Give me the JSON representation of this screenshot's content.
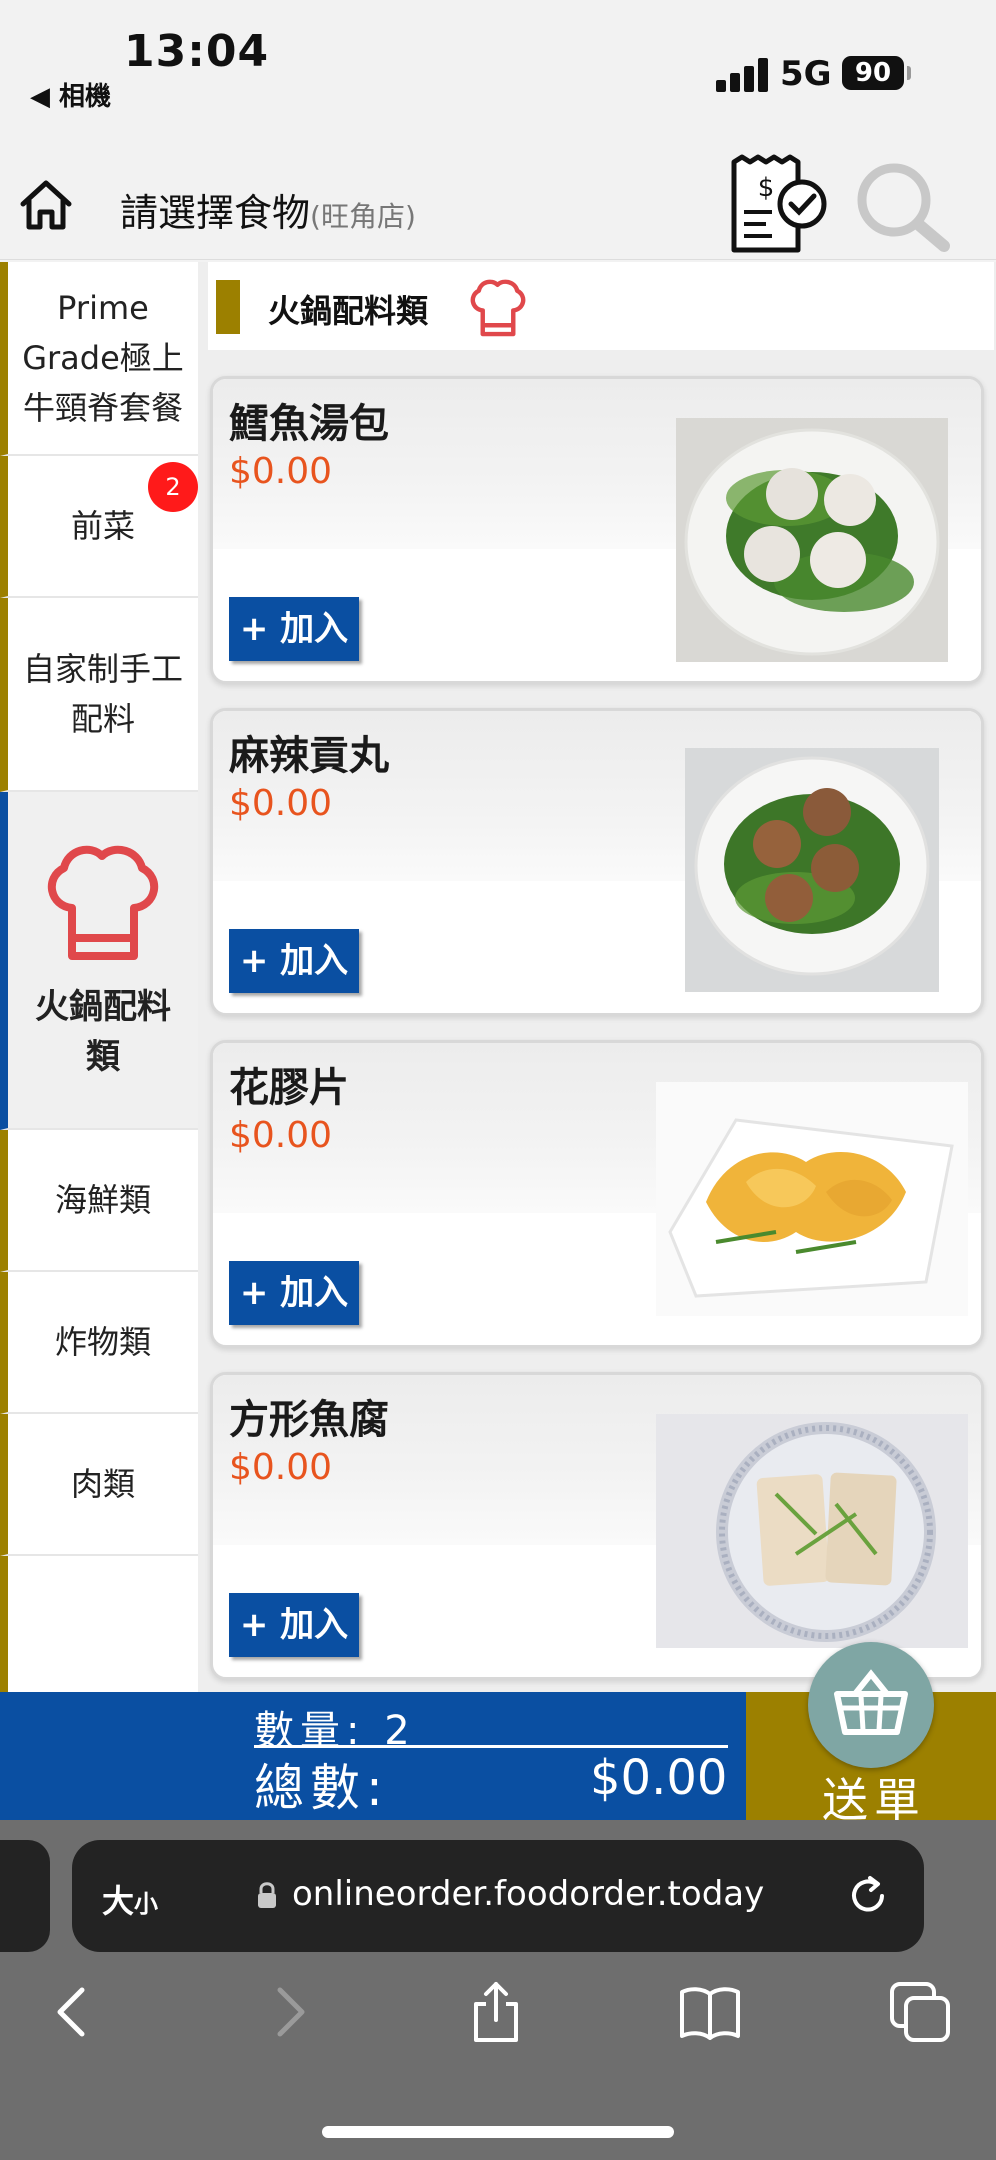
{
  "status_bar": {
    "time": "13:04",
    "back_app": "◀ 相機",
    "network": "5G",
    "battery": "90"
  },
  "header": {
    "title": "請選擇食物",
    "store": "(旺角店)"
  },
  "sidebar": {
    "items": [
      {
        "label": "Prime Grade極上牛頸脊套餐"
      },
      {
        "label": "前菜",
        "badge": "2"
      },
      {
        "label": "自家制手工配料"
      },
      {
        "label": "火鍋配料類",
        "active": true
      },
      {
        "label": "海鮮類"
      },
      {
        "label": "炸物類"
      },
      {
        "label": "肉類"
      }
    ]
  },
  "category": {
    "title": "火鍋配料類"
  },
  "products": [
    {
      "name": "鱈魚湯包",
      "price": "$0.00",
      "add_label": "+ 加入"
    },
    {
      "name": "麻辣貢丸",
      "price": "$0.00",
      "add_label": "+ 加入"
    },
    {
      "name": "花膠片",
      "price": "$0.00",
      "add_label": "+ 加入"
    },
    {
      "name": "方形魚腐",
      "price": "$0.00",
      "add_label": "+ 加入"
    }
  ],
  "order_bar": {
    "quantity": "數量: 2",
    "total_label": "總數:",
    "total_value": "$0.00",
    "submit_label": "送單"
  },
  "browser": {
    "text_size_label": "大",
    "text_size_small": "小",
    "url": "onlineorder.foodorder.today"
  },
  "colors": {
    "brand_blue": "#0a4fa2",
    "gold": "#9c8000",
    "price_orange": "#e8541e",
    "chef_red": "#e0484b",
    "badge_red": "#ff1a1a"
  },
  "icons": [
    "home-icon",
    "receipt-check-icon",
    "search-icon",
    "chef-hat-icon",
    "basket-icon",
    "lock-icon",
    "reload-icon",
    "back-icon",
    "forward-icon",
    "share-icon",
    "bookmarks-icon",
    "tabs-icon"
  ]
}
